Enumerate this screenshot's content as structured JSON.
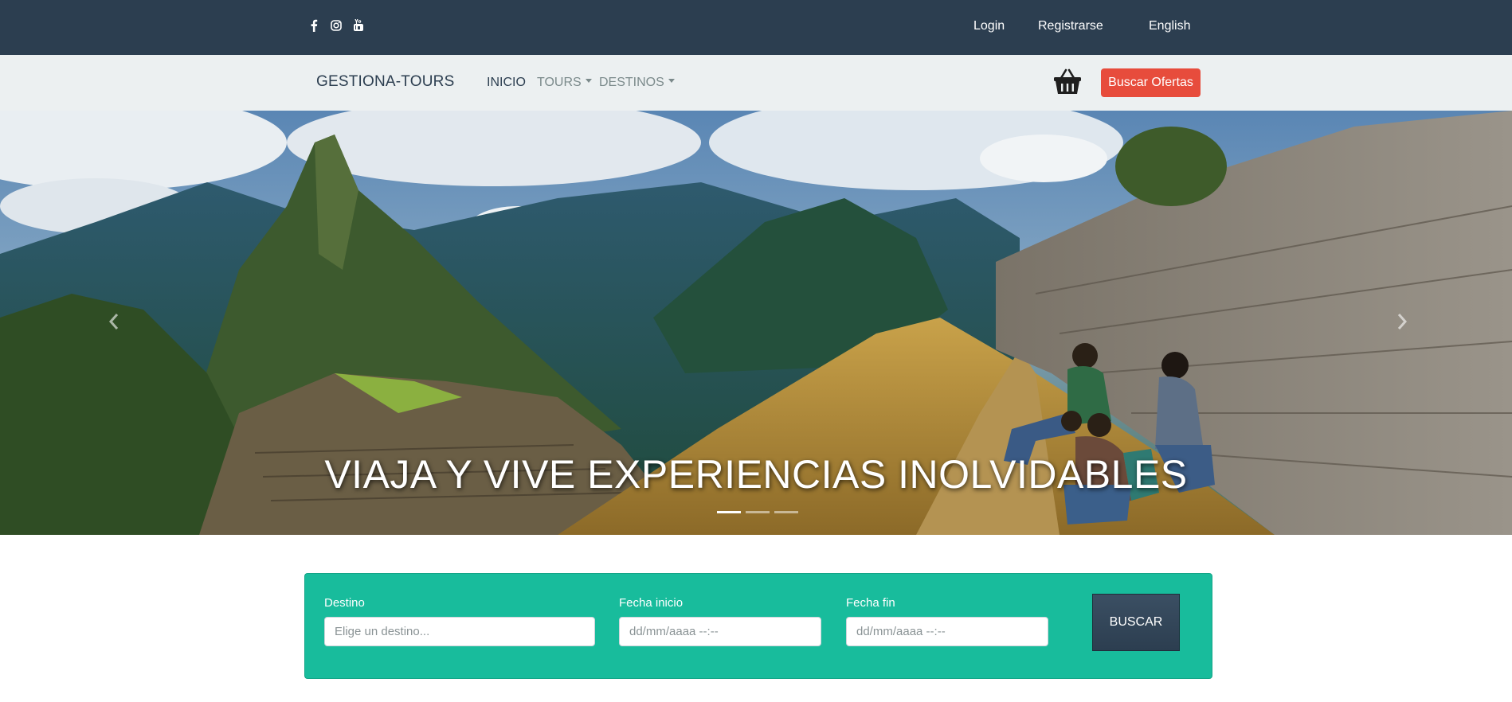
{
  "topbar": {
    "social": [
      "facebook-icon",
      "instagram-icon",
      "youtube-icon"
    ],
    "login": "Login",
    "register": "Registrarse",
    "language": "English"
  },
  "navbar": {
    "brand": "GESTIONA-TOURS",
    "items": [
      {
        "label": "INICIO",
        "dropdown": false,
        "active": true
      },
      {
        "label": "TOURS",
        "dropdown": true,
        "active": false
      },
      {
        "label": "DESTINOS",
        "dropdown": true,
        "active": false
      }
    ],
    "cart_icon": "basket-icon",
    "offers_button": "Buscar Ofertas"
  },
  "hero": {
    "title": "VIAJA Y VIVE EXPERIENCIAS INOLVIDABLES",
    "slides": 3,
    "active_slide": 1
  },
  "search": {
    "destino_label": "Destino",
    "destino_placeholder": "Elige un destino...",
    "fecha_inicio_label": "Fecha inicio",
    "fecha_inicio_value": "dd/mm/aaaa --:--",
    "fecha_fin_label": "Fecha fin",
    "fecha_fin_value": "dd/mm/aaaa --:--",
    "button": "BUSCAR"
  },
  "colors": {
    "topbar": "#2c3e50",
    "navbar": "#ecf0f1",
    "accent_red": "#e74c3c",
    "search_panel": "#18bc9c"
  }
}
